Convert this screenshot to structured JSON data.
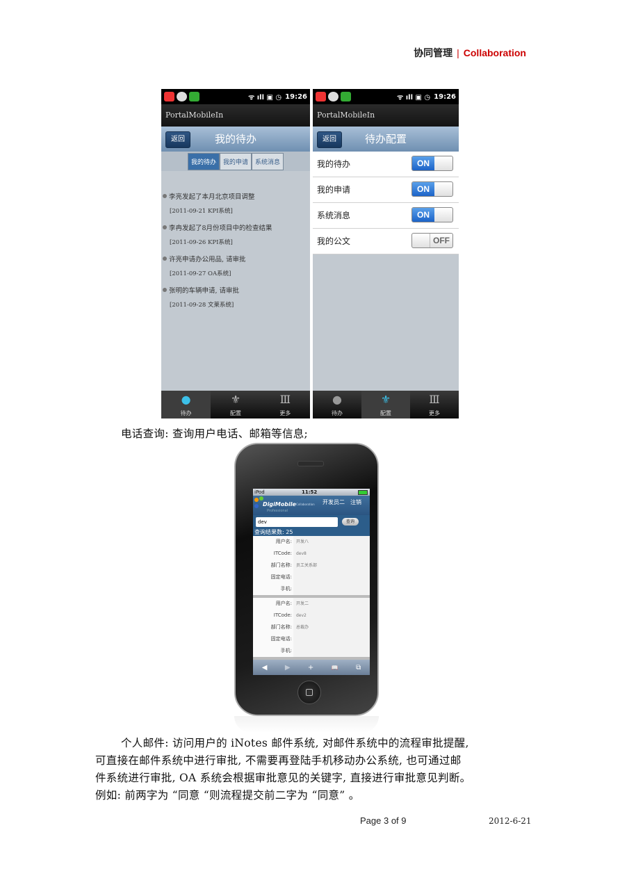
{
  "header": {
    "title_cn": "协同管理",
    "separator": "|",
    "title_en": "Collaboration"
  },
  "left_screen": {
    "status_time": "19:26",
    "status_icons": "ᯤ ıll ▣ ◷",
    "app_bar": "PortalMobileIn",
    "back": "返回",
    "title": "我的待办",
    "segments": [
      "我的待办",
      "我的申请",
      "系统消息"
    ],
    "tasks": [
      {
        "title": "李亮发起了本月北京项目调整",
        "meta": "[2011-09-21  KPI系统]"
      },
      {
        "title": "李冉发起了8月份项目中的检查结果",
        "meta": "[2011-09-26  KPI系统]"
      },
      {
        "title": "许亮申请办公用品, 请审批",
        "meta": "[2011-09-27  OA系统]"
      },
      {
        "title": "张明的车辆申请, 请审批",
        "meta": "[2011-09-28  文莱系统]"
      }
    ],
    "tabs": [
      "待办",
      "配置",
      "更多"
    ]
  },
  "right_screen": {
    "status_time": "19:26",
    "status_icons": "ᯤ ıll ▣ ◷",
    "app_bar": "PortalMobileIn",
    "back": "返回",
    "title": "待办配置",
    "rows": [
      {
        "label": "我的待办",
        "toggle": "ON"
      },
      {
        "label": "我的申请",
        "toggle": "ON"
      },
      {
        "label": "系统消息",
        "toggle": "ON"
      },
      {
        "label": "我的公文",
        "toggle": "OFF"
      }
    ],
    "tabs": [
      "待办",
      "配置",
      "更多"
    ]
  },
  "phone_caption": "电话查询: 查询用户电话、邮箱等信息;",
  "iphone": {
    "carrier": "iPod",
    "time": "11:52",
    "logo": "DigiMobile",
    "logo_sub": "Collaboration",
    "logo_sub2": "Professional",
    "user": "开发员二",
    "logout": "注销",
    "query": "dev",
    "search_btn": "查询",
    "result_count": "查询结果数: 25",
    "labels": [
      "用户名:",
      "ITCode:",
      "部门名称:",
      "固定电话:",
      "手机:"
    ],
    "records": [
      {
        "name": "开发八",
        "itcode": "dev8",
        "dept": "员工关系部",
        "phone": "",
        "mobile": ""
      },
      {
        "name": "开发二",
        "itcode": "dev2",
        "dept": "总裁办",
        "phone": "",
        "mobile": ""
      }
    ],
    "toolbar": [
      "◀",
      "▶",
      "+",
      "📖",
      "⧉"
    ]
  },
  "paragraph": {
    "line1": "个人邮件: 访问用户的 iNotes 邮件系统, 对邮件系统中的流程审批提醒,",
    "line2": "可直接在邮件系统中进行审批, 不需要再登陆手机移动办公系统, 也可通过邮",
    "line3": "件系统进行审批, OA 系统会根据审批意见的关键字, 直接进行审批意见判断。",
    "line4": "例如: 前两字为 “同意 “则流程提交前二字为 “同意” 。"
  },
  "footer": {
    "page": "Page 3 of 9",
    "date": "2012-6-21"
  },
  "colors": {
    "accent": "#cc0000",
    "title_bar": "#7d9bbb",
    "toggle_on": "#1c63c8"
  }
}
